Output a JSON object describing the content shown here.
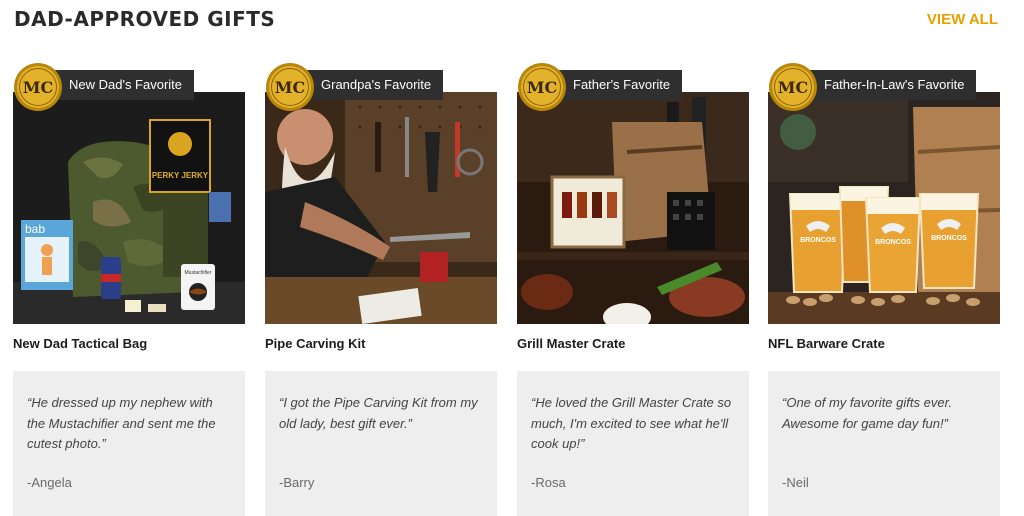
{
  "header": {
    "title": "DAD-APPROVED GIFTS",
    "view_all": "VIEW ALL",
    "accent_color": "#e8a000"
  },
  "badge": {
    "logo_text": "MC",
    "logo_color": "#d9a521"
  },
  "products": [
    {
      "badge": "New Dad's Favorite",
      "name": "New Dad Tactical Bag",
      "quote": "“He dressed up my nephew with the Mustachifier and sent me the cutest photo.”",
      "author": "-Angela",
      "image_icon": "camo-backpack-image"
    },
    {
      "badge": "Grandpa's Favorite",
      "name": "Pipe Carving Kit",
      "quote": "“I got the Pipe Carving Kit from my old lady, best gift ever.”",
      "author": "-Barry",
      "image_icon": "workshop-carving-image"
    },
    {
      "badge": "Father's Favorite",
      "name": "Grill Master Crate",
      "quote": "“He loved the Grill Master Crate so much, I'm excited to see what he'll cook up!”",
      "author": "-Rosa",
      "image_icon": "grill-crate-image"
    },
    {
      "badge": "Father-In-Law's Favorite",
      "name": "NFL Barware Crate",
      "quote": "“One of my favorite gifts ever. Awesome for game day fun!”",
      "author": "-Neil",
      "image_icon": "beer-glasses-image"
    }
  ],
  "image_text": {
    "jerky": "PERKY JERKY",
    "bab": "bab",
    "mustachifier": "Mustachifier",
    "broncos": "BRONCOS"
  }
}
